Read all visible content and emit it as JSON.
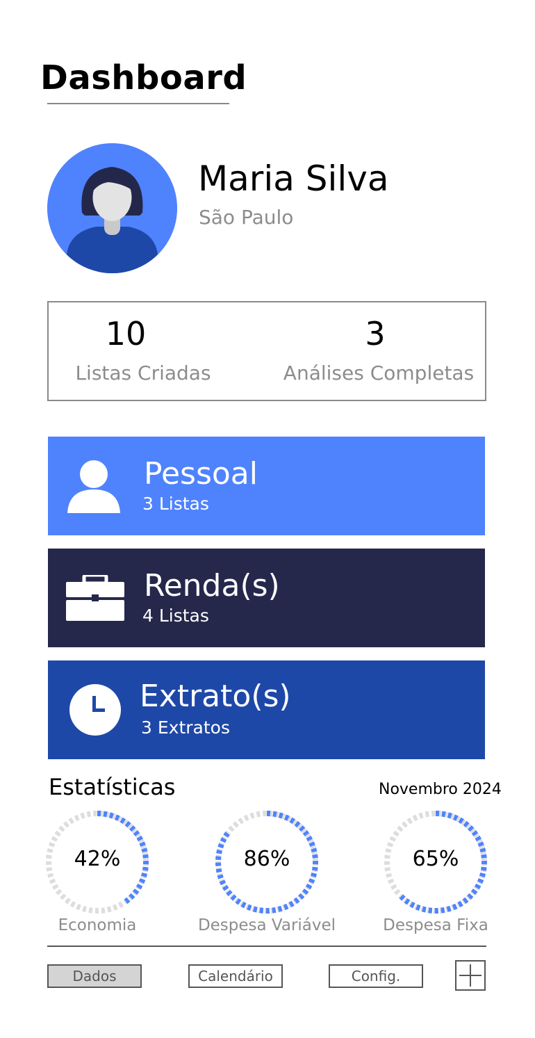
{
  "header": {
    "title": "Dashboard"
  },
  "profile": {
    "name": "Maria Silva",
    "city": "São Paulo",
    "avatar_icon": "user-avatar-icon"
  },
  "summary": {
    "lists_created": {
      "value": "10",
      "label": "Listas Criadas"
    },
    "analyses_completed": {
      "value": "3",
      "label": "Análises Completas"
    }
  },
  "categories": [
    {
      "title": "Pessoal",
      "subtitle": "3 Listas",
      "icon": "person-icon",
      "color": "#4f83fd"
    },
    {
      "title": "Renda(s)",
      "subtitle": "4 Listas",
      "icon": "briefcase-icon",
      "color": "#25284b"
    },
    {
      "title": "Extrato(s)",
      "subtitle": "3 Extratos",
      "icon": "clock-icon",
      "color": "#1e48a8"
    }
  ],
  "statistics": {
    "heading": "Estatísticas",
    "period": "Novembro 2024",
    "items": [
      {
        "label": "Economia",
        "value_text": "42%",
        "value": 42
      },
      {
        "label": "Despesa Variável",
        "value_text": "86%",
        "value": 86
      },
      {
        "label": "Despesa Fixa",
        "value_text": "65%",
        "value": 65
      }
    ]
  },
  "nav": {
    "dados": "Dados",
    "calendario": "Calendário",
    "config": "Config.",
    "add_icon": "plus-icon"
  },
  "colors": {
    "accent": "#4f83fd",
    "dark_navy": "#25284b",
    "royal_blue": "#1e48a8",
    "gauge_track": "#dddddd",
    "muted_text": "#8c8c8c"
  }
}
